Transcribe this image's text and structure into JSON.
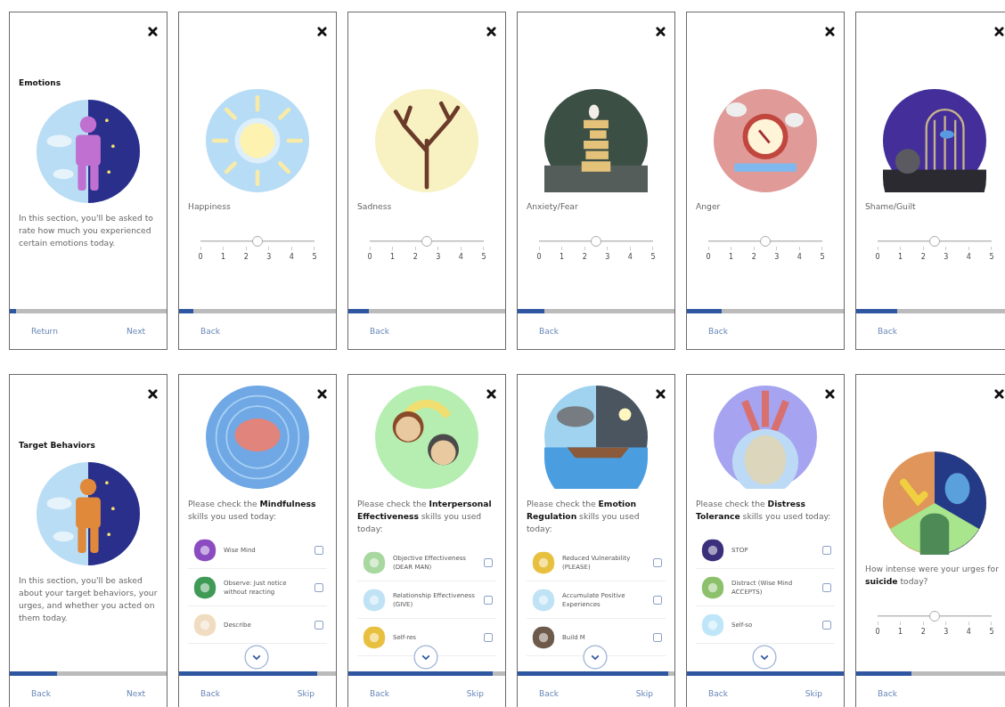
{
  "rows": [
    {
      "screens": [
        {
          "kind": "intro",
          "title": "Emotions",
          "text": "In this section, you'll be asked to rate how much you experienced certain emotions today.",
          "progress": {
            "level": 0.04
          },
          "footer": {
            "left": "Return",
            "right": "Next"
          }
        },
        {
          "kind": "slider",
          "label": "Happiness",
          "slider": {
            "level": 0.5,
            "ticks": [
              "0",
              "1",
              "2",
              "3",
              "4",
              "5"
            ]
          },
          "progress": {
            "level": 0.09
          },
          "footer": {
            "left": "Back"
          }
        },
        {
          "kind": "slider",
          "label": "Sadness",
          "slider": {
            "level": 0.5,
            "ticks": [
              "0",
              "1",
              "2",
              "3",
              "4",
              "5"
            ]
          },
          "progress": {
            "level": 0.13
          },
          "footer": {
            "left": "Back"
          }
        },
        {
          "kind": "slider",
          "label": "Anxiety/Fear",
          "slider": {
            "level": 0.5,
            "ticks": [
              "0",
              "1",
              "2",
              "3",
              "4",
              "5"
            ]
          },
          "progress": {
            "level": 0.17
          },
          "footer": {
            "left": "Back"
          }
        },
        {
          "kind": "slider",
          "label": "Anger",
          "slider": {
            "level": 0.5,
            "ticks": [
              "0",
              "1",
              "2",
              "3",
              "4",
              "5"
            ]
          },
          "progress": {
            "level": 0.22
          },
          "footer": {
            "left": "Back"
          }
        },
        {
          "kind": "slider",
          "label": "Shame/Guilt",
          "slider": {
            "level": 0.5,
            "ticks": [
              "0",
              "1",
              "2",
              "3",
              "4",
              "5"
            ]
          },
          "progress": {
            "level": 0.26
          },
          "footer": {
            "left": "Back"
          }
        }
      ]
    },
    {
      "screens": [
        {
          "kind": "intro",
          "title": "Target Behaviors",
          "text": "In this section, you'll be asked about your target behaviors, your urges, and whether you acted on them today.",
          "progress": {
            "level": 0.3
          },
          "footer": {
            "left": "Back",
            "right": "Next"
          }
        },
        {
          "kind": "checklist",
          "prompt": "Please check the **Mindfulness** skills you used today:",
          "items": [
            {
              "label": "Wise Mind",
              "checked": false
            },
            {
              "label": "Observe: Just notice without reacting",
              "checked": false
            },
            {
              "label": "Describe",
              "checked": false
            }
          ],
          "progress": {
            "level": 0.88
          },
          "footer": {
            "left": "Back",
            "right": "Skip"
          }
        },
        {
          "kind": "checklist",
          "prompt": "Please check the **Interpersonal Effectiveness** skills you used today:",
          "items": [
            {
              "label": "Objective Effectiveness (DEAR MAN)",
              "checked": false
            },
            {
              "label": "Relationship Effectiveness (GIVE)",
              "checked": false
            },
            {
              "label": "Self-res",
              "checked": false
            }
          ],
          "progress": {
            "level": 0.92
          },
          "footer": {
            "left": "Back",
            "right": "Skip"
          }
        },
        {
          "kind": "checklist",
          "prompt": "Please check the **Emotion Regulation** skills you used today:",
          "items": [
            {
              "label": "Reduced Vulnerability (PLEASE)",
              "checked": false
            },
            {
              "label": "Accumulate Positive Experiences",
              "checked": false
            },
            {
              "label": "Build M",
              "checked": false
            }
          ],
          "progress": {
            "level": 0.96
          },
          "footer": {
            "left": "Back",
            "right": "Skip"
          }
        },
        {
          "kind": "checklist",
          "prompt": "Please check the **Distress Tolerance** skills you used today:",
          "items": [
            {
              "label": "STOP",
              "checked": false
            },
            {
              "label": "Distract (Wise Mind ACCEPTS)",
              "checked": false
            },
            {
              "label": "Self-so",
              "checked": false
            }
          ],
          "progress": {
            "level": 1
          },
          "footer": {
            "left": "Back",
            "right": "Skip"
          }
        },
        {
          "kind": "slider",
          "label": "How intense were your urges for **suicide** today?",
          "slider": {
            "level": 0.5,
            "ticks": [
              "0",
              "1",
              "2",
              "3",
              "4",
              "5"
            ]
          },
          "progress": {
            "level": 0.35
          },
          "footer": {
            "left": "Back"
          }
        }
      ]
    }
  ]
}
